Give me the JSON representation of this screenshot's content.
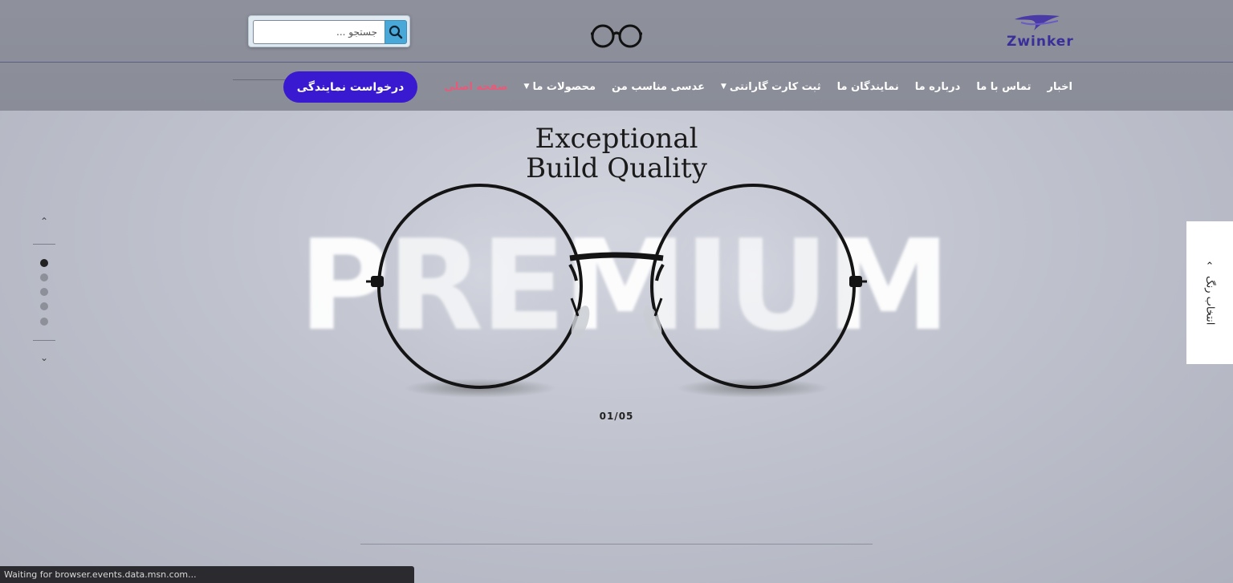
{
  "brand": {
    "logo_text": "Zwinker",
    "logo_color": "#3a2f9a"
  },
  "search": {
    "placeholder": "جستجو ...",
    "icon": "search-icon"
  },
  "nav": {
    "items": [
      {
        "label": "صفحه اصلی",
        "active": true,
        "has_dropdown": false
      },
      {
        "label": "محصولات ما",
        "active": false,
        "has_dropdown": true
      },
      {
        "label": "عدسی مناسب من",
        "active": false,
        "has_dropdown": false
      },
      {
        "label": "ثبت کارت گارانتی",
        "active": false,
        "has_dropdown": true
      },
      {
        "label": "نمایندگان ما",
        "active": false,
        "has_dropdown": false
      },
      {
        "label": "درباره ما",
        "active": false,
        "has_dropdown": false
      },
      {
        "label": "تماس با ما",
        "active": false,
        "has_dropdown": false
      },
      {
        "label": "اخبار",
        "active": false,
        "has_dropdown": false
      }
    ],
    "active_color": "#e85a7a",
    "cta_label": "درخواست نمایندگی",
    "cta_color": "#3a1ad0"
  },
  "hero": {
    "headline_line1": "Exceptional",
    "headline_line2": "Build Quality",
    "background_word": "PREMIUM",
    "counter": "01/05"
  },
  "slider": {
    "up_icon": "chevron-up-icon",
    "down_icon": "chevron-down-icon",
    "total_slides": 5,
    "active_slide": 1
  },
  "color_picker": {
    "label": "انتخاب رنگ",
    "icon": "chevron-up-icon"
  },
  "status_bar": {
    "text": "Waiting for browser.events.data.msn.com..."
  }
}
